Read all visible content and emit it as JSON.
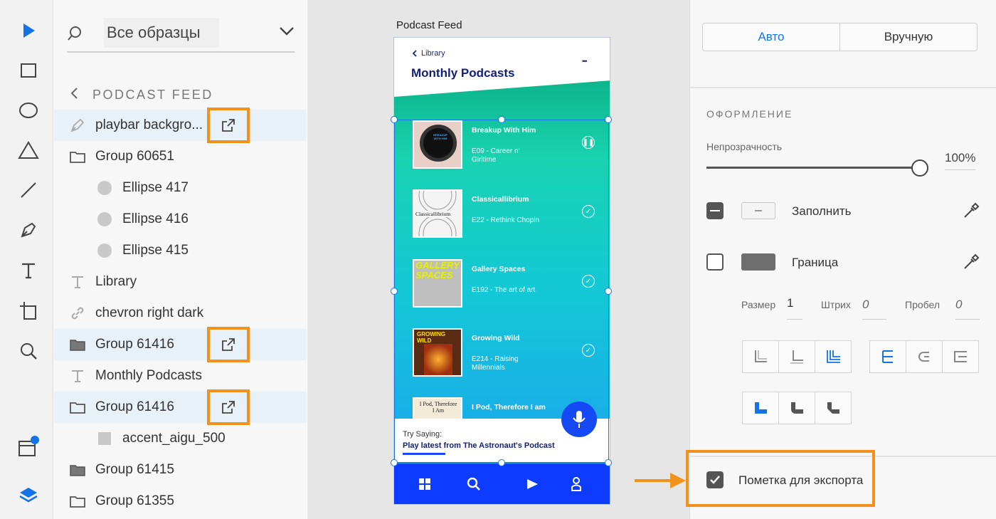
{
  "layers": {
    "search_placeholder": "Все образцы",
    "breadcrumb": "PODCAST FEED",
    "items": [
      {
        "label": "playbar backgro...",
        "icon": "pen-icon",
        "selected": true,
        "export": true
      },
      {
        "label": "Group 60651",
        "icon": "folder-icon"
      },
      {
        "label": "Ellipse 417",
        "icon": "circle-icon"
      },
      {
        "label": "Ellipse 416",
        "icon": "circle-icon"
      },
      {
        "label": "Ellipse 415",
        "icon": "circle-icon"
      },
      {
        "label": "Library",
        "icon": "text-icon"
      },
      {
        "label": "chevron right dark",
        "icon": "link-icon"
      },
      {
        "label": "Group 61416",
        "icon": "folder-filled-icon",
        "selected": true,
        "export": true
      },
      {
        "label": "Monthly Podcasts",
        "icon": "text-icon"
      },
      {
        "label": "Group 61416",
        "icon": "folder-icon",
        "selected": true,
        "export": true
      },
      {
        "label": "accent_aigu_500",
        "icon": "square-icon"
      },
      {
        "label": "Group 61415",
        "icon": "folder-filled-icon"
      },
      {
        "label": "Group 61355",
        "icon": "folder-icon"
      }
    ]
  },
  "canvas": {
    "artboard_label": "Podcast Feed",
    "back_label": "Library",
    "title": "Monthly Podcasts",
    "more": "•••",
    "podcasts": [
      {
        "title": "Breakup With Him",
        "subtitle": "E09 - Career n' Girltime",
        "status": "pause"
      },
      {
        "title": "Classicallibrium",
        "subtitle": "E22 - Rethink Chopin",
        "status": "check"
      },
      {
        "title": "Gallery Spaces",
        "subtitle": "E192 - The art of art",
        "status": "check"
      },
      {
        "title": "Growing Wild",
        "subtitle": "E214 - Raising Millennials",
        "status": "check"
      },
      {
        "title": "I Pod, Therefore I am",
        "subtitle": "",
        "status": ""
      }
    ],
    "covers": {
      "breakup": "BREAKUP WITH HIM",
      "classic": "Classicallibrium",
      "gallery": "GALLERY SPACES",
      "growing": "GROWING WILD",
      "ipod": "I Pod, Therefore I Am"
    },
    "try_saying": "Try Saying:",
    "prompt": "Play latest from The Astronaut's Podcast",
    "nav": [
      "grid-icon",
      "search-icon",
      "play-icon",
      "user-icon"
    ]
  },
  "panel": {
    "mode_auto": "Авто",
    "mode_manual": "Вручную",
    "section": "ОФОРМЛЕНИЕ",
    "opacity_label": "Непрозрачность",
    "opacity_value": "100%",
    "opacity": 1.0,
    "fill_label": "Заполнить",
    "border_label": "Граница",
    "size_label": "Размер",
    "size_value": "1",
    "dash_label": "Штрих",
    "dash_value": "0",
    "gap_label": "Пробел",
    "gap_value": "0",
    "export_label": "Пометка для экспорта",
    "export_checked": true
  },
  "colors": {
    "accent": "#1473e6",
    "highlight": "#f0921c",
    "nav": "#0d3bff"
  }
}
